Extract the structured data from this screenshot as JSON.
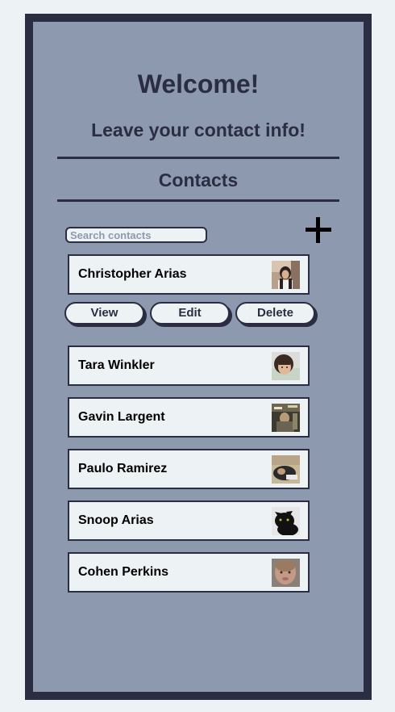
{
  "header": {
    "welcome": "Welcome!",
    "subtitle": "Leave your contact info!",
    "section_title": "Contacts"
  },
  "search": {
    "placeholder": "Search contacts",
    "value": ""
  },
  "add_icon": "plus-icon",
  "selected_actions": {
    "view": "View",
    "edit": "Edit",
    "delete": "Delete"
  },
  "contacts": [
    {
      "name": "Christopher Arias"
    },
    {
      "name": "Tara Winkler"
    },
    {
      "name": "Gavin Largent"
    },
    {
      "name": "Paulo Ramirez"
    },
    {
      "name": "Snoop Arias"
    },
    {
      "name": "Cohen Perkins"
    }
  ],
  "colors": {
    "page_bg": "#edf2f4",
    "panel_bg": "#8d99ae",
    "dark": "#2b2d42",
    "card_bg": "#edf2f4"
  }
}
